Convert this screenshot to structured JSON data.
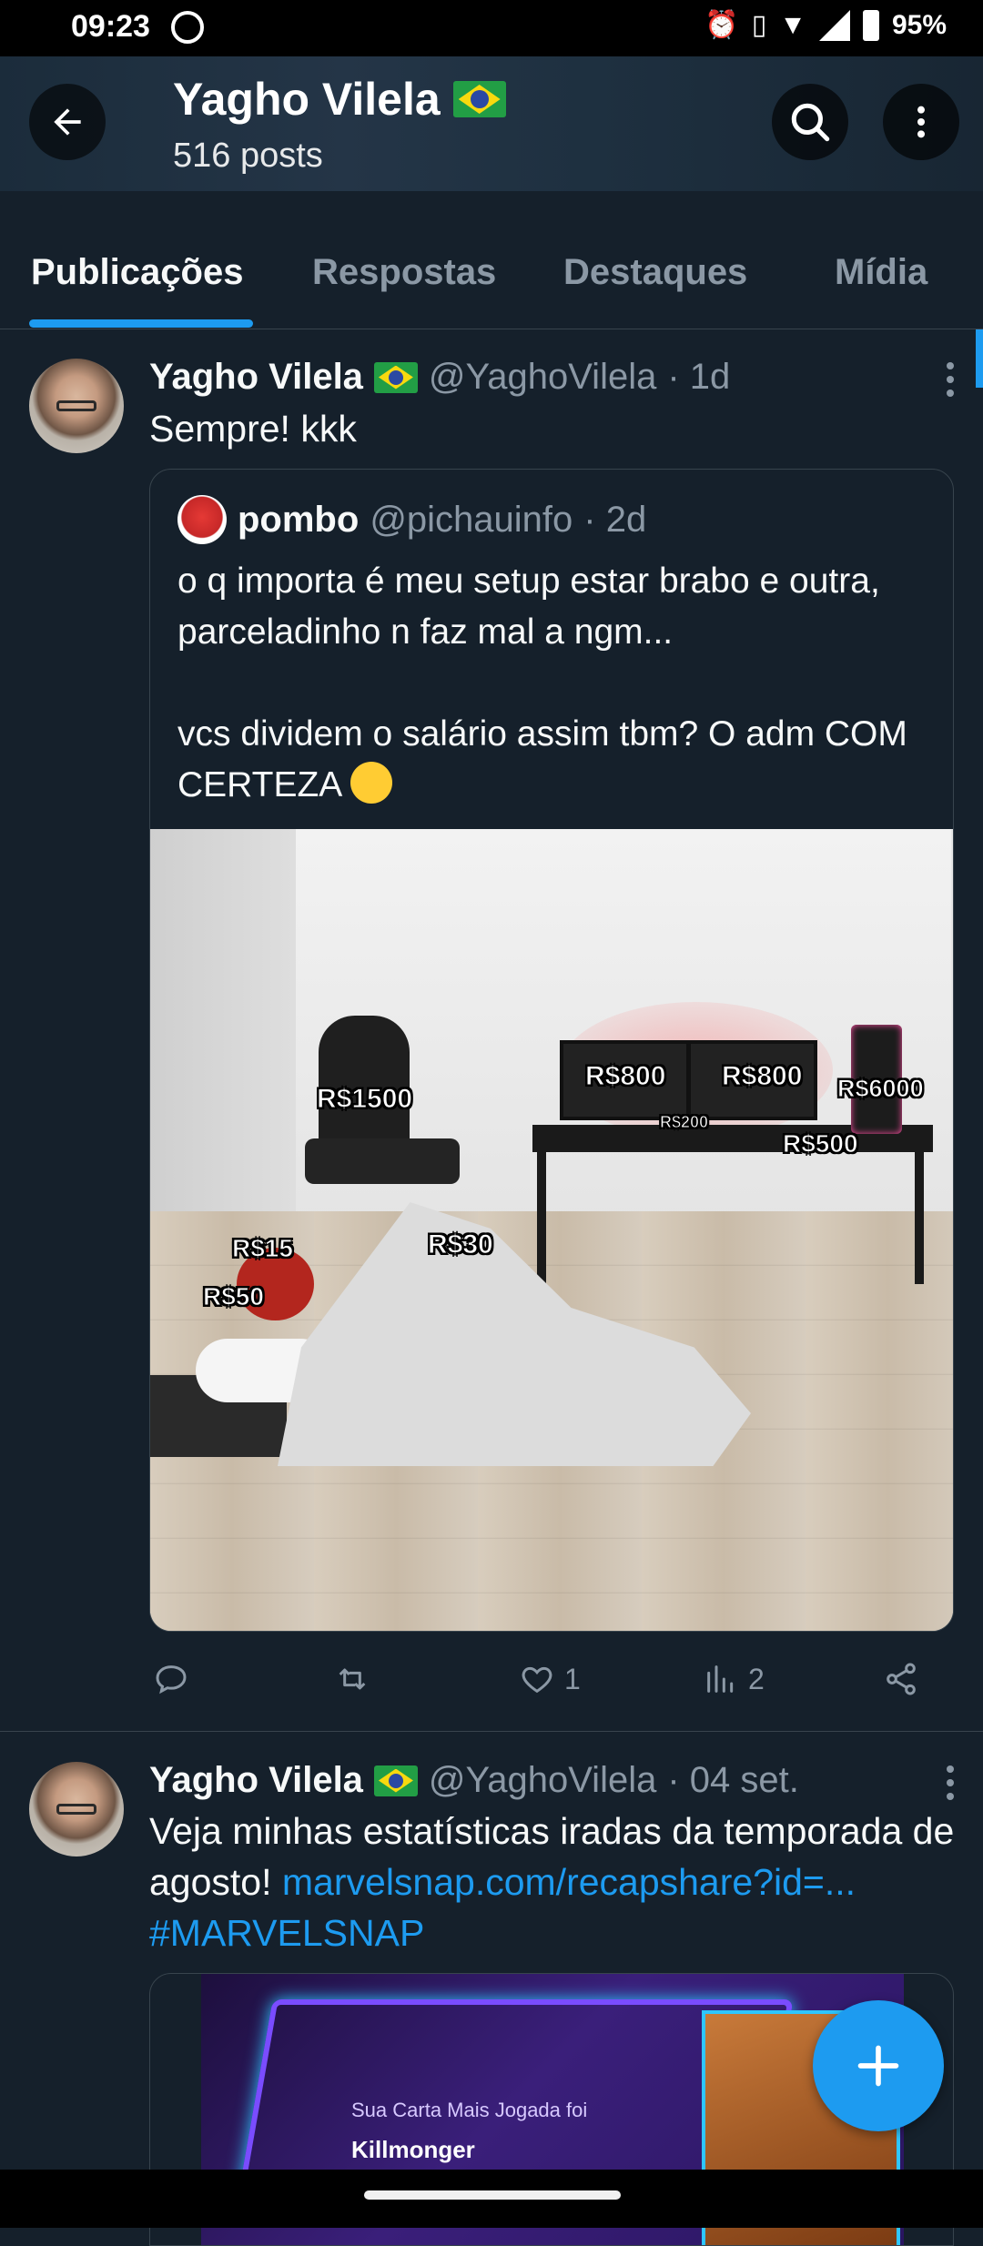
{
  "status_bar": {
    "time": "09:23",
    "battery": "95%"
  },
  "header": {
    "name": "Yagho Vilela",
    "posts": "516 posts"
  },
  "tabs": [
    {
      "label": "Publicações"
    },
    {
      "label": "Respostas"
    },
    {
      "label": "Destaques"
    },
    {
      "label": "Mídia"
    }
  ],
  "posts": [
    {
      "name": "Yagho Vilela",
      "handle": "@YaghoVilela",
      "time": "· 1d",
      "text": "Sempre! kkk",
      "quote": {
        "name": "pombo",
        "handle": "@pichauinfo",
        "time": "· 2d",
        "text_line1": "o q importa é meu setup estar brabo e outra, parceladinho n faz mal a ngm...",
        "text_line2": "vcs dividem o salário assim tbm? O adm COM CERTEZA",
        "image_prices": [
          "R$1500",
          "R$800",
          "R$800",
          "R$6000",
          "R$200",
          "R$500",
          "R$15",
          "R$30",
          "R$50"
        ]
      },
      "actions": {
        "replies": "",
        "reposts": "",
        "likes": "1",
        "views": "2"
      }
    },
    {
      "name": "Yagho Vilela",
      "handle": "@YaghoVilela",
      "time": "· 04 set.",
      "text": "Veja minhas estatísticas iradas da temporada de agosto!",
      "link": "marvelsnap.com/recapshare?id=...",
      "hashtag": "#MARVELSNAP",
      "card": {
        "line1": "Sua Carta Mais Jogada foi",
        "line2": "Killmonger"
      }
    }
  ],
  "colors": {
    "background": "#15202b",
    "accent": "#1d9bf0",
    "muted": "#8b98a5"
  }
}
